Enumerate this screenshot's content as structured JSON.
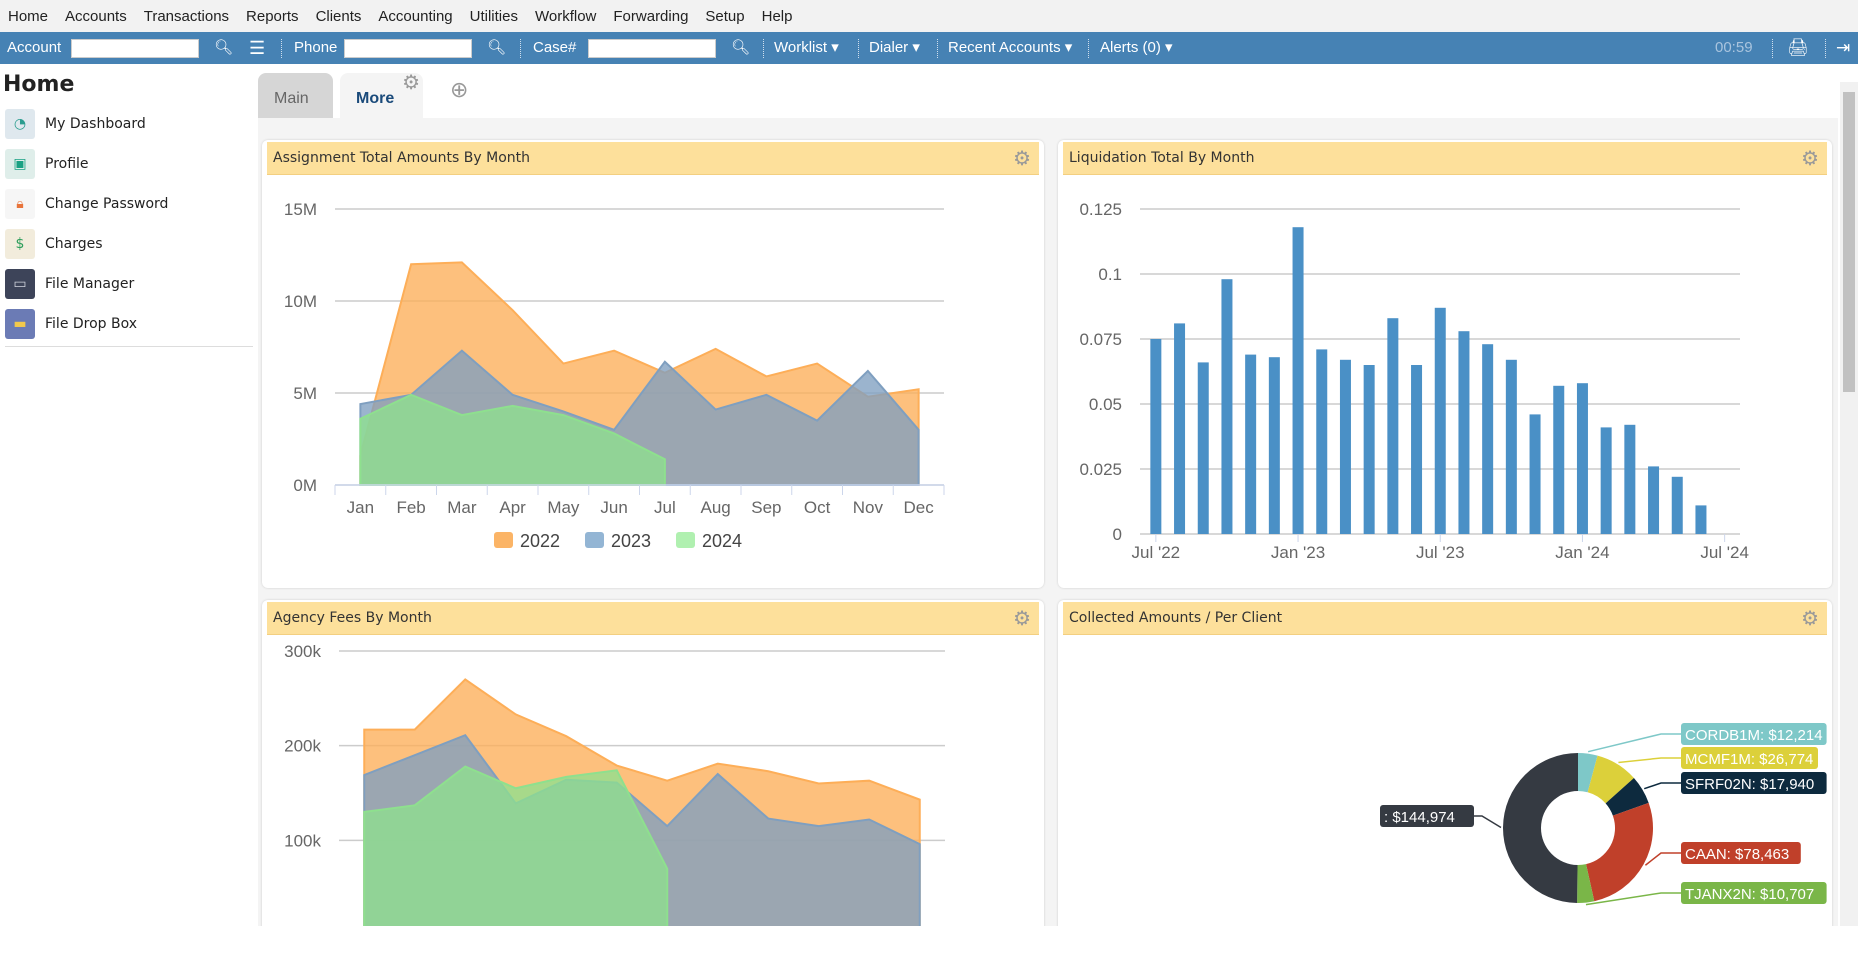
{
  "menu": [
    "Home",
    "Accounts",
    "Transactions",
    "Reports",
    "Clients",
    "Accounting",
    "Utilities",
    "Workflow",
    "Forwarding",
    "Setup",
    "Help"
  ],
  "toolbar": {
    "account": "Account",
    "phone": "Phone",
    "case": "Case#",
    "worklist": "Worklist ▾",
    "dialer": "Dialer ▾",
    "recent": "Recent Accounts ▾",
    "alerts": "Alerts (0) ▾",
    "timer": "00:59"
  },
  "sidebar": {
    "title": "Home",
    "items": [
      {
        "label": "My Dashboard",
        "icon": "dashboard-icon",
        "color": "#dfe8ee"
      },
      {
        "label": "Profile",
        "icon": "id-card-icon",
        "color": "#dfeeea"
      },
      {
        "label": "Change Password",
        "icon": "lock-refresh-icon",
        "color": "#f6f6f6"
      },
      {
        "label": "Charges",
        "icon": "receipt-icon",
        "color": "#f2ecdc"
      },
      {
        "label": "File Manager",
        "icon": "cabinet-icon",
        "color": "#3d4459"
      },
      {
        "label": "File Drop Box",
        "icon": "folder-icon",
        "color": "#6b7bb5"
      }
    ]
  },
  "tabs": {
    "main": "Main",
    "more": "More"
  },
  "colors": {
    "toolbar": "#4682b4",
    "header": "#fde09b",
    "bar": "#4a90c6"
  },
  "chart_data": [
    {
      "type": "area",
      "title": "Assignment Total Amounts By Month",
      "categories": [
        "Jan",
        "Feb",
        "Mar",
        "Apr",
        "May",
        "Jun",
        "Jul",
        "Aug",
        "Sep",
        "Oct",
        "Nov",
        "Dec"
      ],
      "yticks": [
        "0M",
        "5M",
        "10M",
        "15M"
      ],
      "ylim": [
        0,
        15000000
      ],
      "legend": "bottom",
      "series": [
        {
          "name": "2022",
          "color": "#fdae58",
          "legend_color": "#fbb466",
          "values": [
            1600000,
            12000000,
            12100000,
            9500000,
            6600000,
            7300000,
            6100000,
            7400000,
            5900000,
            6600000,
            4800000,
            5200000
          ]
        },
        {
          "name": "2023",
          "color": "#7f9fc0",
          "legend_color": "#93b5d4",
          "values": [
            4400000,
            4900000,
            7300000,
            4900000,
            4000000,
            3000000,
            6700000,
            4100000,
            4900000,
            3500000,
            6200000,
            3000000
          ]
        },
        {
          "name": "2024",
          "color": "#8ee08e",
          "legend_color": "#b0f0b0",
          "values": [
            3600000,
            4900000,
            3800000,
            4300000,
            3800000,
            2800000,
            1400000
          ]
        }
      ]
    },
    {
      "type": "bar",
      "title": "Liquidation Total By Month",
      "yticks": [
        "0",
        "0.025",
        "0.05",
        "0.075",
        "0.1",
        "0.125"
      ],
      "ylim": [
        0,
        0.125
      ],
      "xticks": [
        "Jul '22",
        "Jan '23",
        "Jul '23",
        "Jan '24",
        "Jul '24"
      ],
      "values": [
        0.075,
        0.081,
        0.066,
        0.098,
        0.069,
        0.068,
        0.118,
        0.071,
        0.067,
        0.065,
        0.083,
        0.065,
        0.087,
        0.078,
        0.073,
        0.067,
        0.046,
        0.057,
        0.058,
        0.041,
        0.042,
        0.026,
        0.022,
        0.011
      ]
    },
    {
      "type": "area",
      "title": "Agency Fees By Month",
      "yticks": [
        "100k",
        "200k",
        "300k"
      ],
      "ylim": [
        0,
        300000
      ],
      "series": [
        {
          "color": "#fdae58",
          "values": [
            217000,
            217000,
            270000,
            233000,
            210000,
            179000,
            163000,
            181000,
            173000,
            160000,
            163000,
            143000
          ]
        },
        {
          "color": "#7f9fc0",
          "values": [
            169000,
            190000,
            211000,
            139000,
            164000,
            161000,
            115000,
            170000,
            123000,
            115000,
            122000,
            96000
          ]
        },
        {
          "color": "#8ee08e",
          "values": [
            130000,
            137000,
            178000,
            155000,
            167000,
            174000,
            70000
          ]
        }
      ]
    },
    {
      "type": "pie",
      "title": "Collected Amounts / Per Client",
      "slices": [
        {
          "label": "CORDB1M: $12,214",
          "value": 12214,
          "color": "#7ec8c8"
        },
        {
          "label": "MCMF1M: $26,774",
          "value": 26774,
          "color": "#dcd03a"
        },
        {
          "label": "SFRF02N: $17,940",
          "value": 17940,
          "color": "#0d2a3e"
        },
        {
          "label": "CAAN: $78,463",
          "value": 78463,
          "color": "#c0402a"
        },
        {
          "label": "TJANX2N: $10,707",
          "value": 10707,
          "color": "#7ab648"
        },
        {
          "label": ": $144,974",
          "value": 144974,
          "color": "#353a42"
        }
      ]
    }
  ]
}
